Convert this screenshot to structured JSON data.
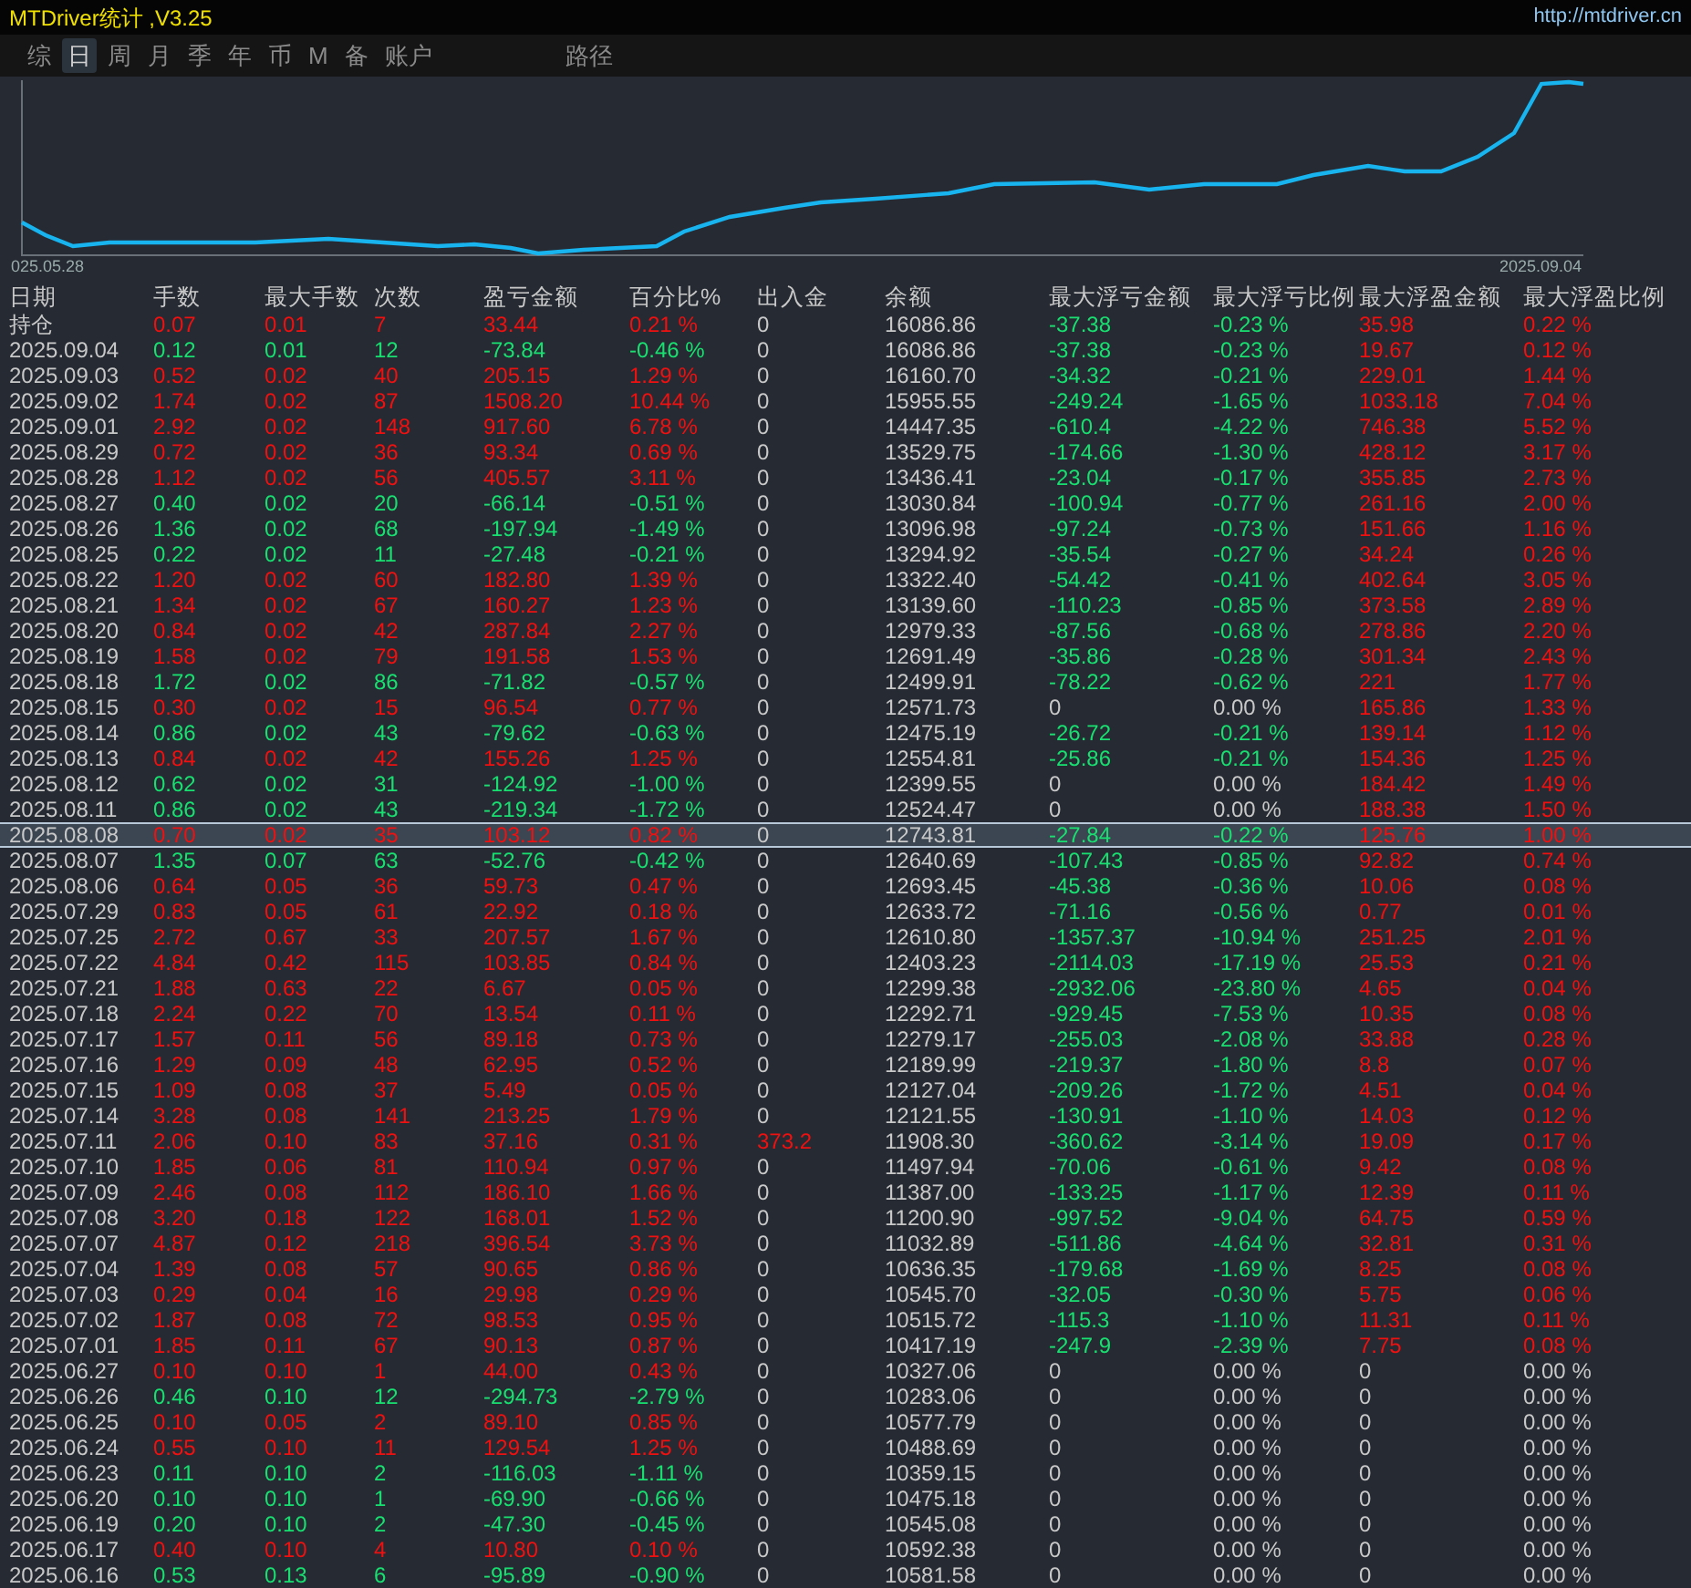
{
  "window": {
    "title": "MTDriver统计 ,V3.25",
    "link": "http://mtdriver.cn"
  },
  "tabs": [
    {
      "label": "综",
      "selected": false
    },
    {
      "label": "日",
      "selected": true
    },
    {
      "label": "周",
      "selected": false
    },
    {
      "label": "月",
      "selected": false
    },
    {
      "label": "季",
      "selected": false
    },
    {
      "label": "年",
      "selected": false
    },
    {
      "label": "币",
      "selected": false
    },
    {
      "label": "M",
      "selected": false
    },
    {
      "label": "备",
      "selected": false
    },
    {
      "label": "账户",
      "selected": false
    }
  ],
  "route_tab": {
    "label": "路径"
  },
  "equity_chart": {
    "start_label": "025.05.28",
    "end_label": "2025.09.04"
  },
  "table": {
    "columns": [
      "日期",
      "手数",
      "最大手数",
      "次数",
      "盈亏金额",
      "百分比%",
      "出入金",
      "余额",
      "最大浮亏金额",
      "最大浮亏比例",
      "最大浮盈金额",
      "最大浮盈比例"
    ],
    "rows": [
      {
        "cells": [
          "持仓",
          "0.07",
          "0.01",
          "7",
          "33.44",
          "0.21 %",
          "0",
          "16086.86",
          "-37.38",
          "-0.23 %",
          "35.98",
          "0.22 %"
        ],
        "profit": true,
        "selected": false,
        "zero_float_loss": false,
        "zero_float_gain": false,
        "cash_flow": false
      },
      {
        "cells": [
          "2025.09.04",
          "0.12",
          "0.01",
          "12",
          "-73.84",
          "-0.46 %",
          "0",
          "16086.86",
          "-37.38",
          "-0.23 %",
          "19.67",
          "0.12 %"
        ],
        "profit": false,
        "selected": false,
        "zero_float_loss": false,
        "zero_float_gain": false,
        "cash_flow": false
      },
      {
        "cells": [
          "2025.09.03",
          "0.52",
          "0.02",
          "40",
          "205.15",
          "1.29 %",
          "0",
          "16160.70",
          "-34.32",
          "-0.21 %",
          "229.01",
          "1.44 %"
        ],
        "profit": true,
        "selected": false,
        "zero_float_loss": false,
        "zero_float_gain": false,
        "cash_flow": false
      },
      {
        "cells": [
          "2025.09.02",
          "1.74",
          "0.02",
          "87",
          "1508.20",
          "10.44 %",
          "0",
          "15955.55",
          "-249.24",
          "-1.65 %",
          "1033.18",
          "7.04 %"
        ],
        "profit": true,
        "selected": false,
        "zero_float_loss": false,
        "zero_float_gain": false,
        "cash_flow": false
      },
      {
        "cells": [
          "2025.09.01",
          "2.92",
          "0.02",
          "148",
          "917.60",
          "6.78 %",
          "0",
          "14447.35",
          "-610.4",
          "-4.22 %",
          "746.38",
          "5.52 %"
        ],
        "profit": true,
        "selected": false,
        "zero_float_loss": false,
        "zero_float_gain": false,
        "cash_flow": false
      },
      {
        "cells": [
          "2025.08.29",
          "0.72",
          "0.02",
          "36",
          "93.34",
          "0.69 %",
          "0",
          "13529.75",
          "-174.66",
          "-1.30 %",
          "428.12",
          "3.17 %"
        ],
        "profit": true,
        "selected": false,
        "zero_float_loss": false,
        "zero_float_gain": false,
        "cash_flow": false
      },
      {
        "cells": [
          "2025.08.28",
          "1.12",
          "0.02",
          "56",
          "405.57",
          "3.11 %",
          "0",
          "13436.41",
          "-23.04",
          "-0.17 %",
          "355.85",
          "2.73 %"
        ],
        "profit": true,
        "selected": false,
        "zero_float_loss": false,
        "zero_float_gain": false,
        "cash_flow": false
      },
      {
        "cells": [
          "2025.08.27",
          "0.40",
          "0.02",
          "20",
          "-66.14",
          "-0.51 %",
          "0",
          "13030.84",
          "-100.94",
          "-0.77 %",
          "261.16",
          "2.00 %"
        ],
        "profit": false,
        "selected": false,
        "zero_float_loss": false,
        "zero_float_gain": false,
        "cash_flow": false
      },
      {
        "cells": [
          "2025.08.26",
          "1.36",
          "0.02",
          "68",
          "-197.94",
          "-1.49 %",
          "0",
          "13096.98",
          "-97.24",
          "-0.73 %",
          "151.66",
          "1.16 %"
        ],
        "profit": false,
        "selected": false,
        "zero_float_loss": false,
        "zero_float_gain": false,
        "cash_flow": false
      },
      {
        "cells": [
          "2025.08.25",
          "0.22",
          "0.02",
          "11",
          "-27.48",
          "-0.21 %",
          "0",
          "13294.92",
          "-35.54",
          "-0.27 %",
          "34.24",
          "0.26 %"
        ],
        "profit": false,
        "selected": false,
        "zero_float_loss": false,
        "zero_float_gain": false,
        "cash_flow": false
      },
      {
        "cells": [
          "2025.08.22",
          "1.20",
          "0.02",
          "60",
          "182.80",
          "1.39 %",
          "0",
          "13322.40",
          "-54.42",
          "-0.41 %",
          "402.64",
          "3.05 %"
        ],
        "profit": true,
        "selected": false,
        "zero_float_loss": false,
        "zero_float_gain": false,
        "cash_flow": false
      },
      {
        "cells": [
          "2025.08.21",
          "1.34",
          "0.02",
          "67",
          "160.27",
          "1.23 %",
          "0",
          "13139.60",
          "-110.23",
          "-0.85 %",
          "373.58",
          "2.89 %"
        ],
        "profit": true,
        "selected": false,
        "zero_float_loss": false,
        "zero_float_gain": false,
        "cash_flow": false
      },
      {
        "cells": [
          "2025.08.20",
          "0.84",
          "0.02",
          "42",
          "287.84",
          "2.27 %",
          "0",
          "12979.33",
          "-87.56",
          "-0.68 %",
          "278.86",
          "2.20 %"
        ],
        "profit": true,
        "selected": false,
        "zero_float_loss": false,
        "zero_float_gain": false,
        "cash_flow": false
      },
      {
        "cells": [
          "2025.08.19",
          "1.58",
          "0.02",
          "79",
          "191.58",
          "1.53 %",
          "0",
          "12691.49",
          "-35.86",
          "-0.28 %",
          "301.34",
          "2.43 %"
        ],
        "profit": true,
        "selected": false,
        "zero_float_loss": false,
        "zero_float_gain": false,
        "cash_flow": false
      },
      {
        "cells": [
          "2025.08.18",
          "1.72",
          "0.02",
          "86",
          "-71.82",
          "-0.57 %",
          "0",
          "12499.91",
          "-78.22",
          "-0.62 %",
          "221",
          "1.77 %"
        ],
        "profit": false,
        "selected": false,
        "zero_float_loss": false,
        "zero_float_gain": false,
        "cash_flow": false
      },
      {
        "cells": [
          "2025.08.15",
          "0.30",
          "0.02",
          "15",
          "96.54",
          "0.77 %",
          "0",
          "12571.73",
          "0",
          "0.00 %",
          "165.86",
          "1.33 %"
        ],
        "profit": true,
        "selected": false,
        "zero_float_loss": true,
        "zero_float_gain": false,
        "cash_flow": false
      },
      {
        "cells": [
          "2025.08.14",
          "0.86",
          "0.02",
          "43",
          "-79.62",
          "-0.63 %",
          "0",
          "12475.19",
          "-26.72",
          "-0.21 %",
          "139.14",
          "1.12 %"
        ],
        "profit": false,
        "selected": false,
        "zero_float_loss": false,
        "zero_float_gain": false,
        "cash_flow": false
      },
      {
        "cells": [
          "2025.08.13",
          "0.84",
          "0.02",
          "42",
          "155.26",
          "1.25 %",
          "0",
          "12554.81",
          "-25.86",
          "-0.21 %",
          "154.36",
          "1.25 %"
        ],
        "profit": true,
        "selected": false,
        "zero_float_loss": false,
        "zero_float_gain": false,
        "cash_flow": false
      },
      {
        "cells": [
          "2025.08.12",
          "0.62",
          "0.02",
          "31",
          "-124.92",
          "-1.00 %",
          "0",
          "12399.55",
          "0",
          "0.00 %",
          "184.42",
          "1.49 %"
        ],
        "profit": false,
        "selected": false,
        "zero_float_loss": true,
        "zero_float_gain": false,
        "cash_flow": false
      },
      {
        "cells": [
          "2025.08.11",
          "0.86",
          "0.02",
          "43",
          "-219.34",
          "-1.72 %",
          "0",
          "12524.47",
          "0",
          "0.00 %",
          "188.38",
          "1.50 %"
        ],
        "profit": false,
        "selected": false,
        "zero_float_loss": true,
        "zero_float_gain": false,
        "cash_flow": false
      },
      {
        "cells": [
          "2025.08.08",
          "0.70",
          "0.02",
          "35",
          "103.12",
          "0.82 %",
          "0",
          "12743.81",
          "-27.84",
          "-0.22 %",
          "125.76",
          "1.00 %"
        ],
        "profit": true,
        "selected": true,
        "zero_float_loss": false,
        "zero_float_gain": false,
        "cash_flow": false
      },
      {
        "cells": [
          "2025.08.07",
          "1.35",
          "0.07",
          "63",
          "-52.76",
          "-0.42 %",
          "0",
          "12640.69",
          "-107.43",
          "-0.85 %",
          "92.82",
          "0.74 %"
        ],
        "profit": false,
        "selected": false,
        "zero_float_loss": false,
        "zero_float_gain": false,
        "cash_flow": false
      },
      {
        "cells": [
          "2025.08.06",
          "0.64",
          "0.05",
          "36",
          "59.73",
          "0.47 %",
          "0",
          "12693.45",
          "-45.38",
          "-0.36 %",
          "10.06",
          "0.08 %"
        ],
        "profit": true,
        "selected": false,
        "zero_float_loss": false,
        "zero_float_gain": false,
        "cash_flow": false
      },
      {
        "cells": [
          "2025.07.29",
          "0.83",
          "0.05",
          "61",
          "22.92",
          "0.18 %",
          "0",
          "12633.72",
          "-71.16",
          "-0.56 %",
          "0.77",
          "0.01 %"
        ],
        "profit": true,
        "selected": false,
        "zero_float_loss": false,
        "zero_float_gain": false,
        "cash_flow": false
      },
      {
        "cells": [
          "2025.07.25",
          "2.72",
          "0.67",
          "33",
          "207.57",
          "1.67 %",
          "0",
          "12610.80",
          "-1357.37",
          "-10.94 %",
          "251.25",
          "2.01 %"
        ],
        "profit": true,
        "selected": false,
        "zero_float_loss": false,
        "zero_float_gain": false,
        "cash_flow": false
      },
      {
        "cells": [
          "2025.07.22",
          "4.84",
          "0.42",
          "115",
          "103.85",
          "0.84 %",
          "0",
          "12403.23",
          "-2114.03",
          "-17.19 %",
          "25.53",
          "0.21 %"
        ],
        "profit": true,
        "selected": false,
        "zero_float_loss": false,
        "zero_float_gain": false,
        "cash_flow": false
      },
      {
        "cells": [
          "2025.07.21",
          "1.88",
          "0.63",
          "22",
          "6.67",
          "0.05 %",
          "0",
          "12299.38",
          "-2932.06",
          "-23.80 %",
          "4.65",
          "0.04 %"
        ],
        "profit": true,
        "selected": false,
        "zero_float_loss": false,
        "zero_float_gain": false,
        "cash_flow": false
      },
      {
        "cells": [
          "2025.07.18",
          "2.24",
          "0.22",
          "70",
          "13.54",
          "0.11 %",
          "0",
          "12292.71",
          "-929.45",
          "-7.53 %",
          "10.35",
          "0.08 %"
        ],
        "profit": true,
        "selected": false,
        "zero_float_loss": false,
        "zero_float_gain": false,
        "cash_flow": false
      },
      {
        "cells": [
          "2025.07.17",
          "1.57",
          "0.11",
          "56",
          "89.18",
          "0.73 %",
          "0",
          "12279.17",
          "-255.03",
          "-2.08 %",
          "33.88",
          "0.28 %"
        ],
        "profit": true,
        "selected": false,
        "zero_float_loss": false,
        "zero_float_gain": false,
        "cash_flow": false
      },
      {
        "cells": [
          "2025.07.16",
          "1.29",
          "0.09",
          "48",
          "62.95",
          "0.52 %",
          "0",
          "12189.99",
          "-219.37",
          "-1.80 %",
          "8.8",
          "0.07 %"
        ],
        "profit": true,
        "selected": false,
        "zero_float_loss": false,
        "zero_float_gain": false,
        "cash_flow": false
      },
      {
        "cells": [
          "2025.07.15",
          "1.09",
          "0.08",
          "37",
          "5.49",
          "0.05 %",
          "0",
          "12127.04",
          "-209.26",
          "-1.72 %",
          "4.51",
          "0.04 %"
        ],
        "profit": true,
        "selected": false,
        "zero_float_loss": false,
        "zero_float_gain": false,
        "cash_flow": false
      },
      {
        "cells": [
          "2025.07.14",
          "3.28",
          "0.08",
          "141",
          "213.25",
          "1.79 %",
          "0",
          "12121.55",
          "-130.91",
          "-1.10 %",
          "14.03",
          "0.12 %"
        ],
        "profit": true,
        "selected": false,
        "zero_float_loss": false,
        "zero_float_gain": false,
        "cash_flow": false
      },
      {
        "cells": [
          "2025.07.11",
          "2.06",
          "0.10",
          "83",
          "37.16",
          "0.31 %",
          "373.2",
          "11908.30",
          "-360.62",
          "-3.14 %",
          "19.09",
          "0.17 %"
        ],
        "profit": true,
        "selected": false,
        "zero_float_loss": false,
        "zero_float_gain": false,
        "cash_flow": true
      },
      {
        "cells": [
          "2025.07.10",
          "1.85",
          "0.06",
          "81",
          "110.94",
          "0.97 %",
          "0",
          "11497.94",
          "-70.06",
          "-0.61 %",
          "9.42",
          "0.08 %"
        ],
        "profit": true,
        "selected": false,
        "zero_float_loss": false,
        "zero_float_gain": false,
        "cash_flow": false
      },
      {
        "cells": [
          "2025.07.09",
          "2.46",
          "0.08",
          "112",
          "186.10",
          "1.66 %",
          "0",
          "11387.00",
          "-133.25",
          "-1.17 %",
          "12.39",
          "0.11 %"
        ],
        "profit": true,
        "selected": false,
        "zero_float_loss": false,
        "zero_float_gain": false,
        "cash_flow": false
      },
      {
        "cells": [
          "2025.07.08",
          "3.20",
          "0.18",
          "122",
          "168.01",
          "1.52 %",
          "0",
          "11200.90",
          "-997.52",
          "-9.04 %",
          "64.75",
          "0.59 %"
        ],
        "profit": true,
        "selected": false,
        "zero_float_loss": false,
        "zero_float_gain": false,
        "cash_flow": false
      },
      {
        "cells": [
          "2025.07.07",
          "4.87",
          "0.12",
          "218",
          "396.54",
          "3.73 %",
          "0",
          "11032.89",
          "-511.86",
          "-4.64 %",
          "32.81",
          "0.31 %"
        ],
        "profit": true,
        "selected": false,
        "zero_float_loss": false,
        "zero_float_gain": false,
        "cash_flow": false
      },
      {
        "cells": [
          "2025.07.04",
          "1.39",
          "0.08",
          "57",
          "90.65",
          "0.86 %",
          "0",
          "10636.35",
          "-179.68",
          "-1.69 %",
          "8.25",
          "0.08 %"
        ],
        "profit": true,
        "selected": false,
        "zero_float_loss": false,
        "zero_float_gain": false,
        "cash_flow": false
      },
      {
        "cells": [
          "2025.07.03",
          "0.29",
          "0.04",
          "16",
          "29.98",
          "0.29 %",
          "0",
          "10545.70",
          "-32.05",
          "-0.30 %",
          "5.75",
          "0.06 %"
        ],
        "profit": true,
        "selected": false,
        "zero_float_loss": false,
        "zero_float_gain": false,
        "cash_flow": false
      },
      {
        "cells": [
          "2025.07.02",
          "1.87",
          "0.08",
          "72",
          "98.53",
          "0.95 %",
          "0",
          "10515.72",
          "-115.3",
          "-1.10 %",
          "11.31",
          "0.11 %"
        ],
        "profit": true,
        "selected": false,
        "zero_float_loss": false,
        "zero_float_gain": false,
        "cash_flow": false
      },
      {
        "cells": [
          "2025.07.01",
          "1.85",
          "0.11",
          "67",
          "90.13",
          "0.87 %",
          "0",
          "10417.19",
          "-247.9",
          "-2.39 %",
          "7.75",
          "0.08 %"
        ],
        "profit": true,
        "selected": false,
        "zero_float_loss": false,
        "zero_float_gain": false,
        "cash_flow": false
      },
      {
        "cells": [
          "2025.06.27",
          "0.10",
          "0.10",
          "1",
          "44.00",
          "0.43 %",
          "0",
          "10327.06",
          "0",
          "0.00 %",
          "0",
          "0.00 %"
        ],
        "profit": true,
        "selected": false,
        "zero_float_loss": true,
        "zero_float_gain": true,
        "cash_flow": false
      },
      {
        "cells": [
          "2025.06.26",
          "0.46",
          "0.10",
          "12",
          "-294.73",
          "-2.79 %",
          "0",
          "10283.06",
          "0",
          "0.00 %",
          "0",
          "0.00 %"
        ],
        "profit": false,
        "selected": false,
        "zero_float_loss": true,
        "zero_float_gain": true,
        "cash_flow": false
      },
      {
        "cells": [
          "2025.06.25",
          "0.10",
          "0.05",
          "2",
          "89.10",
          "0.85 %",
          "0",
          "10577.79",
          "0",
          "0.00 %",
          "0",
          "0.00 %"
        ],
        "profit": true,
        "selected": false,
        "zero_float_loss": true,
        "zero_float_gain": true,
        "cash_flow": false
      },
      {
        "cells": [
          "2025.06.24",
          "0.55",
          "0.10",
          "11",
          "129.54",
          "1.25 %",
          "0",
          "10488.69",
          "0",
          "0.00 %",
          "0",
          "0.00 %"
        ],
        "profit": true,
        "selected": false,
        "zero_float_loss": true,
        "zero_float_gain": true,
        "cash_flow": false
      },
      {
        "cells": [
          "2025.06.23",
          "0.11",
          "0.10",
          "2",
          "-116.03",
          "-1.11 %",
          "0",
          "10359.15",
          "0",
          "0.00 %",
          "0",
          "0.00 %"
        ],
        "profit": false,
        "selected": false,
        "zero_float_loss": true,
        "zero_float_gain": true,
        "cash_flow": false
      },
      {
        "cells": [
          "2025.06.20",
          "0.10",
          "0.10",
          "1",
          "-69.90",
          "-0.66 %",
          "0",
          "10475.18",
          "0",
          "0.00 %",
          "0",
          "0.00 %"
        ],
        "profit": false,
        "selected": false,
        "zero_float_loss": true,
        "zero_float_gain": true,
        "cash_flow": false
      },
      {
        "cells": [
          "2025.06.19",
          "0.20",
          "0.10",
          "2",
          "-47.30",
          "-0.45 %",
          "0",
          "10545.08",
          "0",
          "0.00 %",
          "0",
          "0.00 %"
        ],
        "profit": false,
        "selected": false,
        "zero_float_loss": true,
        "zero_float_gain": true,
        "cash_flow": false
      },
      {
        "cells": [
          "2025.06.17",
          "0.40",
          "0.10",
          "4",
          "10.80",
          "0.10 %",
          "0",
          "10592.38",
          "0",
          "0.00 %",
          "0",
          "0.00 %"
        ],
        "profit": true,
        "selected": false,
        "zero_float_loss": true,
        "zero_float_gain": true,
        "cash_flow": false
      },
      {
        "cells": [
          "2025.06.16",
          "0.53",
          "0.13",
          "6",
          "-95.89",
          "-0.90 %",
          "0",
          "10581.58",
          "0",
          "0.00 %",
          "0",
          "0.00 %"
        ],
        "profit": false,
        "selected": false,
        "zero_float_loss": true,
        "zero_float_gain": true,
        "cash_flow": false
      }
    ]
  }
}
